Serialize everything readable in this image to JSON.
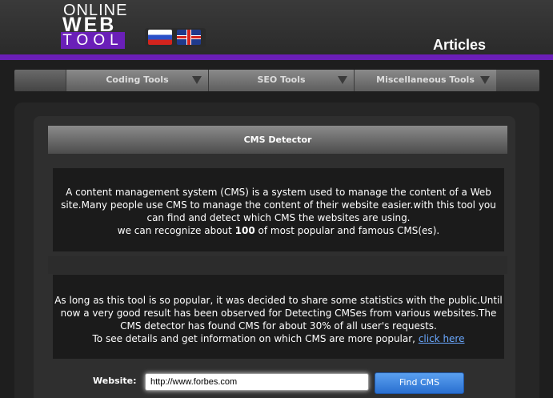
{
  "header": {
    "logo": {
      "line1": "ONLINE",
      "line2": "WEB",
      "line3": "TOOL"
    },
    "languages": [
      "Russian flag",
      "English flag"
    ],
    "articles_label": "Articles"
  },
  "nav": {
    "items": [
      {
        "label": "Coding Tools"
      },
      {
        "label": "SEO Tools"
      },
      {
        "label": "Miscellaneous Tools"
      }
    ]
  },
  "main": {
    "title": "CMS Detector",
    "intro_line1": "A content management system (CMS) is a system used to manage the content of a Web site.Many people use CMS to manage the content of their website easier.with this tool you can find and detect which CMS the websites are using.",
    "intro_line2_prefix": "we can recognize about ",
    "intro_line2_number": "100",
    "intro_line2_suffix": " of most popular and famous CMS(es).",
    "stats_text": "As long as this tool is so popular, it was decided to share some statistics with the public.Until now a very good result has been observed for Detecting CMSes from various websites.The CMS detector has found CMS for about 30% of all user's requests.",
    "stats_link_prefix": "To see details and get information on which CMS are more popular, ",
    "stats_link_label": "click here",
    "website_label": "Website:",
    "website_value": "http://www.forbes.com",
    "find_button": "Find CMS"
  },
  "colors": {
    "accent": "#6b1eb8",
    "button": "#3a82e0",
    "link": "#6aa8ff"
  }
}
